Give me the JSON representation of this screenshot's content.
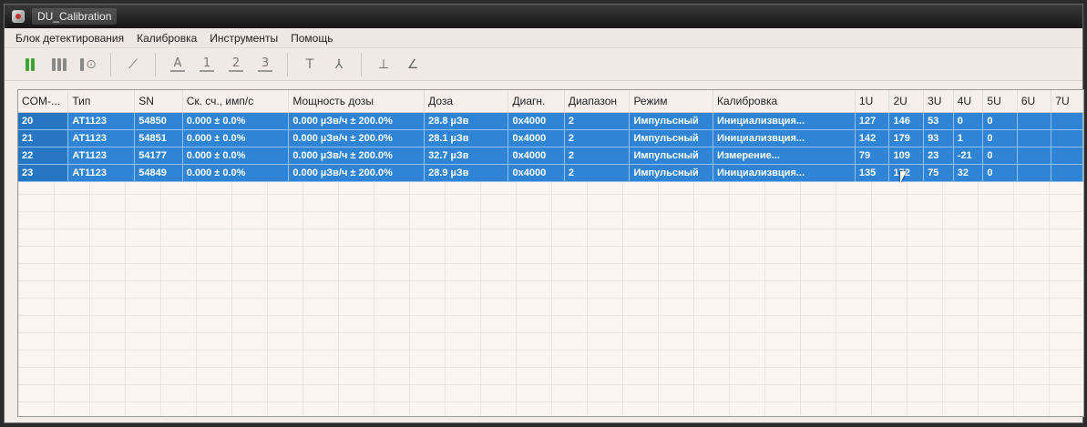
{
  "window": {
    "title": "DU_Calibration"
  },
  "menu": [
    "Блок детектирования",
    "Калибровка",
    "Инструменты",
    "Помощь"
  ],
  "toolbar": {
    "labels": {
      "a": "A",
      "n1": "1",
      "n2": "2",
      "n3": "3",
      "t": "T"
    }
  },
  "table": {
    "columns": [
      "COM-...",
      "Тип",
      "SN",
      "Ск. сч., имп/с",
      "Мощность дозы",
      "Доза",
      "Диагн.",
      "Диапазон",
      "Режим",
      "Калибровка",
      "1U",
      "2U",
      "3U",
      "4U",
      "5U",
      "6U",
      "7U"
    ],
    "rows": [
      [
        "20",
        "AT1123",
        "54850",
        "0.000 ± 0.0%",
        "0.000 µЗв/ч ± 200.0%",
        "28.8 µЗв",
        "0x4000",
        "2",
        "Импульсный",
        "Инициализвция...",
        "127",
        "146",
        "53",
        "0",
        "0",
        "",
        ""
      ],
      [
        "21",
        "AT1123",
        "54851",
        "0.000 ± 0.0%",
        "0.000 µЗв/ч ± 200.0%",
        "28.1 µЗв",
        "0x4000",
        "2",
        "Импульсный",
        "Инициализвция...",
        "142",
        "179",
        "93",
        "1",
        "0",
        "",
        ""
      ],
      [
        "22",
        "AT1123",
        "54177",
        "0.000 ± 0.0%",
        "0.000 µЗв/ч ± 200.0%",
        "32.7 µЗв",
        "0x4000",
        "2",
        "Импульсный",
        "Измерение...",
        "79",
        "109",
        "23",
        "-21",
        "0",
        "",
        ""
      ],
      [
        "23",
        "AT1123",
        "54849",
        "0.000 ± 0.0%",
        "0.000 µЗв/ч ± 200.0%",
        "28.9 µЗв",
        "0x4000",
        "2",
        "Импульсный",
        "Инициализвция...",
        "135",
        "172",
        "75",
        "32",
        "0",
        "",
        ""
      ]
    ]
  }
}
